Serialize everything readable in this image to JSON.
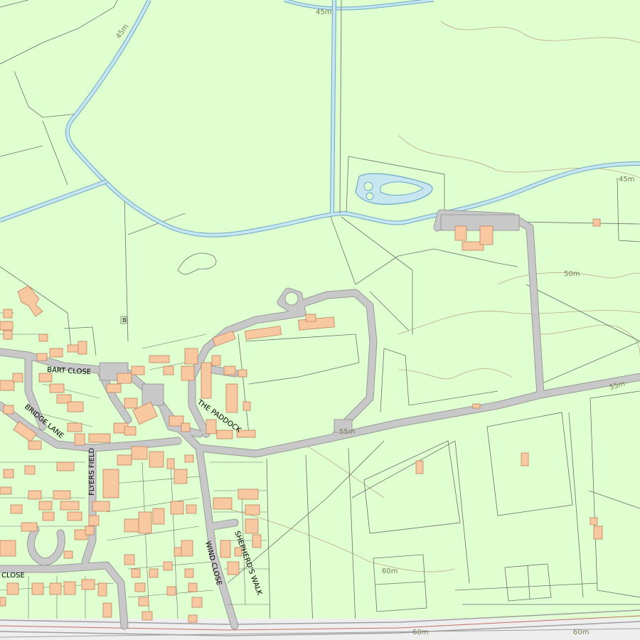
{
  "colors": {
    "land": "#dfffd0",
    "water_fill": "#c8e6f0",
    "water_edge": "#6aa8c8",
    "road": "#c8c8c8",
    "road_edge": "#9a9a9a",
    "building": "#f8c8a0",
    "building_edge": "#c08060",
    "boundary": "#707070",
    "contour": "#b8a080",
    "rail": "#a0a0a0"
  },
  "labels": {
    "bart_close": "BART CLOSE",
    "bridge_lane": "BRIDGE LANE",
    "flyers_field": "FLYERS FIELD",
    "the_paddock": "THE PADDOCK",
    "wind_close": "WIND CLOSE",
    "shepherds_walk": "SHEPHERD'S WALK",
    "close_sw": "CLOSE",
    "benchmark": "B"
  },
  "contours": {
    "c45_top": "45m",
    "c45_river": "45m",
    "c45_right": "45m",
    "c50": "50m",
    "c55_right": "55m",
    "c55_road": "55m",
    "c60_field": "60m",
    "c60_rail_a": "60m",
    "c60_rail_b": "60m"
  }
}
